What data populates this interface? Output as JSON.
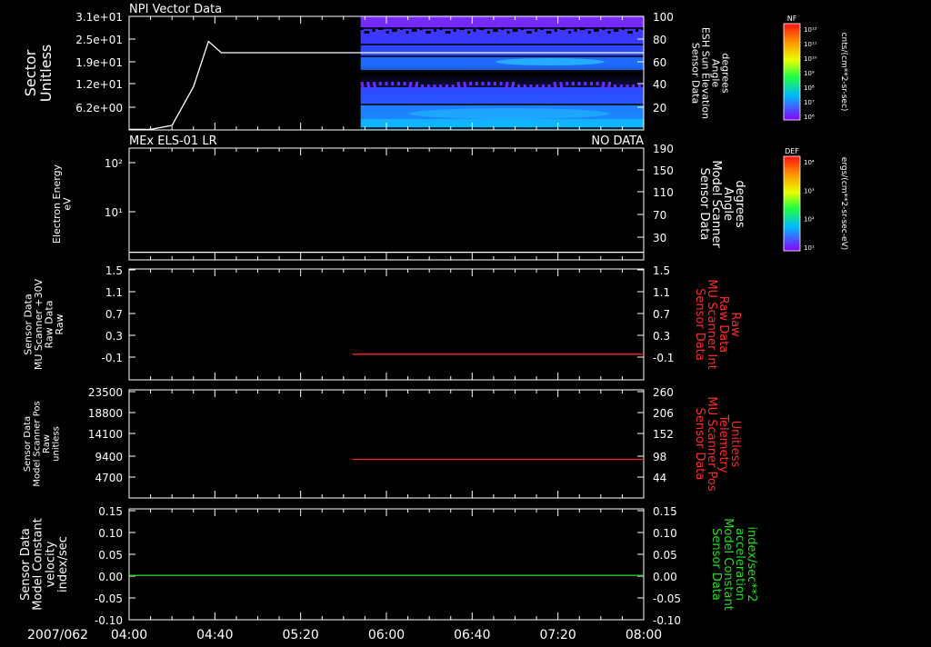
{
  "chart_data": [
    {
      "id": "p1",
      "type": "line+heatmap",
      "title": "NPI Vector Data",
      "status": "",
      "left_label": [
        "Sector",
        "Unitless"
      ],
      "left_label_size": 16,
      "left_ticks": [
        "3.1e+01",
        "2.5e+01",
        "1.9e+01",
        "1.2e+01",
        "6.2e+00"
      ],
      "right_label": [
        "Sensor Data",
        "ESH Sun Elevation",
        "Angle",
        "degrees"
      ],
      "right_label_color": "#ffffff",
      "right_ticks": [
        "100",
        "80",
        "60",
        "40",
        "20"
      ],
      "line_color": "#ffffff",
      "x": [
        "04:00",
        "04:10",
        "04:20",
        "04:30",
        "04:37",
        "04:43",
        "04:50",
        "05:00",
        "06:00",
        "07:00",
        "08:00"
      ],
      "y": [
        0.5,
        0.5,
        4,
        38,
        78,
        68,
        68,
        68,
        68,
        68,
        68
      ],
      "y_range": [
        0,
        100
      ],
      "heatmap": {
        "start": "05:48",
        "end": "08:00"
      }
    },
    {
      "id": "p2",
      "type": "line",
      "title": "MEx ELS-01 LR",
      "status": "NO DATA",
      "left_label": [
        "Electron Energy",
        "eV"
      ],
      "left_label_size": 11,
      "left_ticks": [
        "10²",
        "10¹"
      ],
      "right_label": [
        "Sensor Data",
        "Model Scanner",
        "Angle",
        "degrees"
      ],
      "right_label_color": "#ffffff",
      "right_ticks": [
        "190",
        "150",
        "110",
        "70",
        "30"
      ],
      "line_color": "#ffffff",
      "x": [
        "04:00",
        "08:00"
      ],
      "y": [
        13,
        13
      ],
      "y_range": [
        0,
        190
      ]
    },
    {
      "id": "p3",
      "type": "line",
      "title": "",
      "status": "",
      "left_label": [
        "Sensor Data",
        "MU Scanner +30V",
        "Raw Data",
        "Raw"
      ],
      "left_label_size": 11,
      "left_ticks": [
        "1.5",
        "1.1",
        "0.7",
        "0.3",
        "-0.1"
      ],
      "right_label": [
        "Sensor Data",
        "MU Scanner Int",
        "Raw Data",
        "Raw"
      ],
      "right_label_color": "#ff2a2a",
      "right_ticks": [
        "1.5",
        "1.1",
        "0.7",
        "0.3",
        "-0.1"
      ],
      "line_color": "#ff2020",
      "x": [
        "05:44",
        "08:00"
      ],
      "y": [
        0.0,
        0.0
      ],
      "y_range": [
        -0.45,
        1.5
      ]
    },
    {
      "id": "p4",
      "type": "line",
      "title": "",
      "status": "",
      "left_label": [
        "Sensor Data",
        "Model Scanner Pos",
        "Raw",
        "unitless"
      ],
      "left_label_size": 10,
      "left_ticks": [
        "23500",
        "18800",
        "14100",
        "9400",
        "4700"
      ],
      "right_label": [
        "Sensor Data",
        "MU Scanner Pos",
        "Telemetry",
        "Unitless"
      ],
      "right_label_color": "#ff2a2a",
      "right_ticks": [
        "260",
        "206",
        "152",
        "98",
        "44"
      ],
      "line_color": "#ff2020",
      "x": [
        "05:44",
        "08:00"
      ],
      "y": [
        85,
        85
      ],
      "y_range": [
        -12,
        260
      ]
    },
    {
      "id": "p5",
      "type": "line",
      "title": "",
      "status": "",
      "left_label": [
        "Sensor Data",
        "Model Constant",
        "velocity",
        "index/sec"
      ],
      "left_label_size": 13,
      "left_ticks": [
        "0.15",
        "0.10",
        "0.05",
        "0.00",
        "-0.05",
        "-0.10"
      ],
      "right_label": [
        "Sensor Data",
        "Model Constant",
        "acceleration",
        "index/sec**2"
      ],
      "right_label_color": "#22dd22",
      "right_ticks": [
        "0.15",
        "0.10",
        "0.05",
        "0.00",
        "-0.05",
        "-0.10"
      ],
      "line_color": "#22cc22",
      "x": [
        "04:00",
        "08:00"
      ],
      "y": [
        0.0,
        0.0
      ],
      "y_range": [
        -0.1,
        0.15
      ]
    }
  ],
  "x_axis": {
    "date_label": "2007/062",
    "ticks": [
      "04:00",
      "04:40",
      "05:20",
      "06:00",
      "06:40",
      "07:20",
      "08:00"
    ]
  },
  "colorbars": [
    {
      "name": "NF",
      "label": "cnts/(cm**2-sr-sec)",
      "ticks": [
        "10¹²",
        "10¹¹",
        "10¹⁰",
        "10⁹",
        "10⁸",
        "10⁷",
        "10⁶"
      ]
    },
    {
      "name": "DEF",
      "label": "ergs/(cm**2-sr-sec-eV)",
      "ticks": [
        "10⁴",
        "10³",
        "10²",
        "10¹"
      ]
    }
  ]
}
